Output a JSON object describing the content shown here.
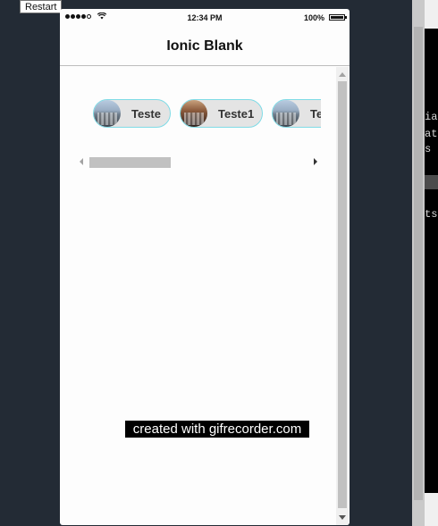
{
  "tooltip": {
    "text": "Restart"
  },
  "status_bar": {
    "time": "12:34 PM",
    "battery_percent": "100%",
    "battery_level": 1.0,
    "signal_bars": 4,
    "signal_total": 5
  },
  "toolbar": {
    "title": "Ionic Blank"
  },
  "chips": [
    {
      "label": "Teste",
      "avatar": "city-photo"
    },
    {
      "label": "Teste1",
      "avatar": "interior-photo"
    },
    {
      "label": "Teste",
      "avatar": "city-photo"
    }
  ],
  "terminal": {
    "lines": [
      "ia",
      "ati",
      "s",
      "ts"
    ]
  },
  "watermark": {
    "text": "created with gifrecorder.com"
  },
  "colors": {
    "chip_border": "#7fdbe6",
    "chip_background": "#e4e4e4",
    "desktop_background": "#232b35"
  }
}
